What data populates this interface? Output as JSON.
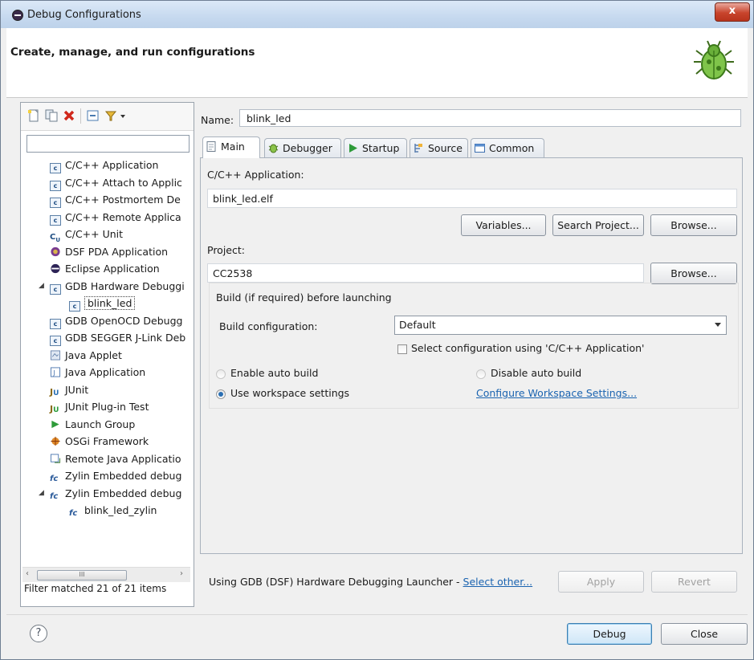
{
  "window": {
    "title": "Debug Configurations",
    "close_label": "x"
  },
  "header": {
    "title": "Create, manage, and run configurations"
  },
  "left_panel": {
    "filter_value": "",
    "tree": [
      {
        "label": "C/C++ Application",
        "icon": "c-icon",
        "level": 1
      },
      {
        "label": "C/C++ Attach to Applic",
        "icon": "c-icon",
        "level": 1
      },
      {
        "label": "C/C++ Postmortem De",
        "icon": "c-icon",
        "level": 1
      },
      {
        "label": "C/C++ Remote Applica",
        "icon": "c-icon",
        "level": 1
      },
      {
        "label": "C/C++ Unit",
        "icon": "cu-icon",
        "level": 1
      },
      {
        "label": "DSF PDA Application",
        "icon": "pda-icon",
        "level": 1
      },
      {
        "label": "Eclipse Application",
        "icon": "eclipse-icon",
        "level": 1
      },
      {
        "label": "GDB Hardware Debuggi",
        "icon": "c-icon",
        "level": 1,
        "expanded": true
      },
      {
        "label": "blink_led",
        "icon": "c-icon",
        "level": 2,
        "selected": true
      },
      {
        "label": "GDB OpenOCD Debugg",
        "icon": "c-icon",
        "level": 1
      },
      {
        "label": "GDB SEGGER J-Link Deb",
        "icon": "c-icon",
        "level": 1
      },
      {
        "label": "Java Applet",
        "icon": "applet-icon",
        "level": 1
      },
      {
        "label": "Java Application",
        "icon": "java-icon",
        "level": 1
      },
      {
        "label": "JUnit",
        "icon": "junit-icon",
        "level": 1
      },
      {
        "label": "JUnit Plug-in Test",
        "icon": "junit-plugin-icon",
        "level": 1
      },
      {
        "label": "Launch Group",
        "icon": "launch-icon",
        "level": 1
      },
      {
        "label": "OSGi Framework",
        "icon": "osgi-icon",
        "level": 1
      },
      {
        "label": "Remote Java Applicatio",
        "icon": "remote-java-icon",
        "level": 1
      },
      {
        "label": "Zylin Embedded debug",
        "icon": "zylin-icon",
        "level": 1
      },
      {
        "label": "Zylin Embedded debug",
        "icon": "zylin-icon",
        "level": 1,
        "expanded": true
      },
      {
        "label": "blink_led_zylin",
        "icon": "zylin-icon",
        "level": 2
      }
    ],
    "scroll_thumb": "III",
    "status": "Filter matched 21 of 21 items"
  },
  "config": {
    "name_label": "Name:",
    "name_value": "blink_led",
    "tabs": [
      {
        "label": "Main",
        "icon": "main-icon"
      },
      {
        "label": "Debugger",
        "icon": "debugger-icon"
      },
      {
        "label": "Startup",
        "icon": "startup-icon"
      },
      {
        "label": "Source",
        "icon": "source-icon"
      },
      {
        "label": "Common",
        "icon": "common-icon"
      }
    ],
    "active_tab": "Main",
    "app_label": "C/C++ Application:",
    "app_value": "blink_led.elf",
    "variables_btn": "Variables...",
    "search_project_btn": "Search Project...",
    "browse_btn": "Browse...",
    "project_label": "Project:",
    "project_value": "CC2538",
    "project_browse_btn": "Browse...",
    "build_group_title": "Build (if required) before launching",
    "build_config_label": "Build configuration:",
    "build_config_value": "Default",
    "select_config_label": "Select configuration using 'C/C++ Application'",
    "enable_auto_build": "Enable auto build",
    "disable_auto_build": "Disable auto build",
    "use_workspace": "Use workspace settings",
    "configure_workspace_link": "Configure Workspace Settings...",
    "launcher_text": "Using GDB (DSF) Hardware Debugging Launcher - ",
    "select_other_link": "Select other...",
    "apply_btn": "Apply",
    "revert_btn": "Revert"
  },
  "footer": {
    "help": "?",
    "debug_btn": "Debug",
    "close_btn": "Close"
  }
}
